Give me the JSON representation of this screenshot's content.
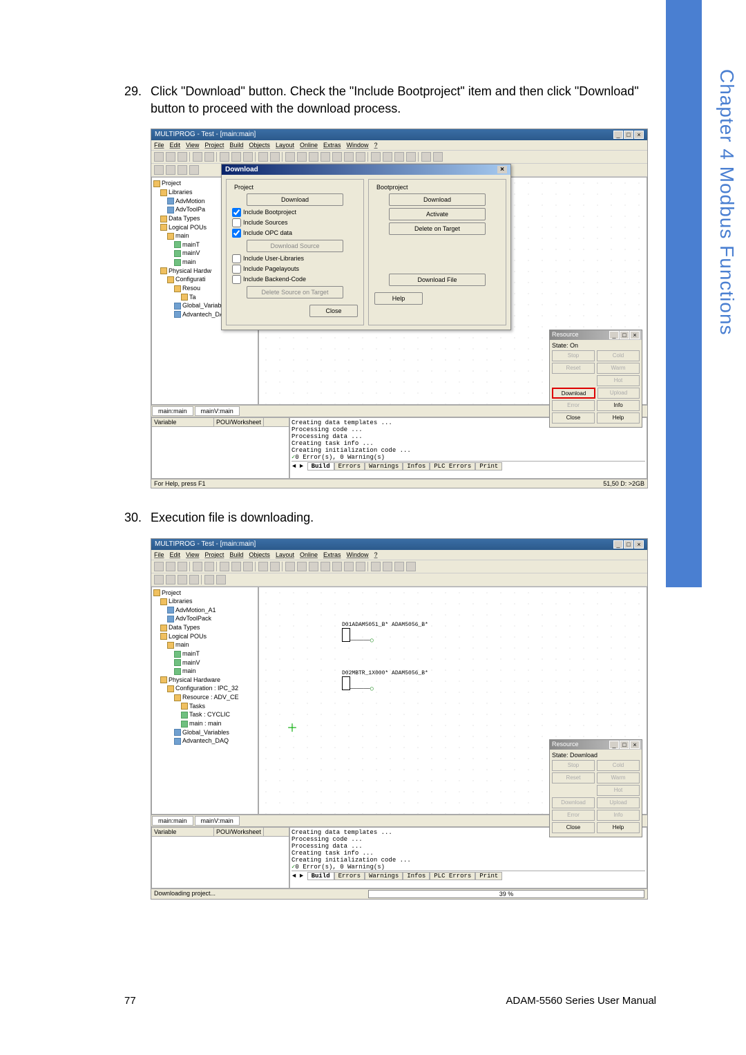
{
  "side_tab": "Chapter 4   Modbus Functions",
  "step29": {
    "num": "29.",
    "text": "Click \"Download\" button. Check the \"Include Bootproject\" item and then click \"Download\" button to proceed with the download process."
  },
  "step30": {
    "num": "30.",
    "text": "Execution file is downloading."
  },
  "screenshot1": {
    "title": "MULTIPROG - Test - [main:main]",
    "menu": [
      "File",
      "Edit",
      "View",
      "Project",
      "Build",
      "Objects",
      "Layout",
      "Online",
      "Extras",
      "Window",
      "?"
    ],
    "tree": {
      "root": "Project",
      "items": [
        {
          "l": 1,
          "t": "Libraries",
          "ic": "f"
        },
        {
          "l": 2,
          "t": "AdvMotion",
          "ic": "b"
        },
        {
          "l": 2,
          "t": "AdvToolPa",
          "ic": "b"
        },
        {
          "l": 1,
          "t": "Data Types",
          "ic": "f"
        },
        {
          "l": 1,
          "t": "Logical POUs",
          "ic": "f"
        },
        {
          "l": 2,
          "t": "main",
          "ic": "f"
        },
        {
          "l": 3,
          "t": "mainT",
          "ic": "g"
        },
        {
          "l": 3,
          "t": "mainV",
          "ic": "g"
        },
        {
          "l": 3,
          "t": "main",
          "ic": "g"
        },
        {
          "l": 1,
          "t": "Physical Hardw",
          "ic": "f"
        },
        {
          "l": 2,
          "t": "Configurati",
          "ic": "f"
        },
        {
          "l": 3,
          "t": "Resou",
          "ic": "f"
        },
        {
          "l": 4,
          "t": "Ta",
          "ic": "f"
        },
        {
          "l": 3,
          "t": "Global_Variables",
          "ic": "b"
        },
        {
          "l": 3,
          "t": "Advantech_DAQ",
          "ic": "b"
        }
      ]
    },
    "dialog": {
      "title": "Download",
      "groupProject": "Project",
      "groupBoot": "Bootproject",
      "btn_download_p": "Download",
      "btn_download_b": "Download",
      "btn_activate": "Activate",
      "btn_delete_target": "Delete on Target",
      "btn_download_source": "Download Source",
      "btn_delete_source": "Delete Source on Target",
      "btn_download_file": "Download File",
      "btn_close": "Close",
      "btn_help": "Help",
      "chk_bootproject": "Include Bootproject",
      "chk_sources": "Include Sources",
      "chk_opc": "Include OPC data",
      "chk_userlib": "Include User-Libraries",
      "chk_pagelayout": "Include Pagelayouts",
      "chk_backend": "Include Backend-Code"
    },
    "resource": {
      "title": "Resource",
      "state_label": "State:",
      "state_value": "On",
      "btn_stop": "Stop",
      "btn_cold": "Cold",
      "btn_reset": "Reset",
      "btn_warm": "Warm",
      "btn_hot": "Hot",
      "btn_download": "Download",
      "btn_upload": "Upload",
      "btn_error": "Error",
      "btn_info": "Info",
      "btn_close": "Close",
      "btn_help": "Help"
    },
    "tabs": [
      "main:main",
      "mainV:main"
    ],
    "var_hdr": [
      "Variable",
      "POU/Worksheet"
    ],
    "output": [
      "Creating data templates ...",
      "Processing code ...",
      "Processing data ...",
      "Creating task info ...",
      "Creating initialization code ...",
      "0 Error(s), 0 Warning(s)"
    ],
    "otabs": [
      "Build",
      "Errors",
      "Warnings",
      "Infos",
      "PLC Errors",
      "Print"
    ],
    "status_left": "For Help, press F1",
    "status_right": "51,50  D: >2GB"
  },
  "screenshot2": {
    "title": "MULTIPROG - Test - [main:main]",
    "menu": [
      "File",
      "Edit",
      "View",
      "Project",
      "Build",
      "Objects",
      "Layout",
      "Online",
      "Extras",
      "Window",
      "?"
    ],
    "tree": {
      "root": "Project",
      "items": [
        {
          "l": 1,
          "t": "Libraries",
          "ic": "f"
        },
        {
          "l": 2,
          "t": "AdvMotion_A1",
          "ic": "b"
        },
        {
          "l": 2,
          "t": "AdvToolPack",
          "ic": "b"
        },
        {
          "l": 1,
          "t": "Data Types",
          "ic": "f"
        },
        {
          "l": 1,
          "t": "Logical POUs",
          "ic": "f"
        },
        {
          "l": 2,
          "t": "main",
          "ic": "f"
        },
        {
          "l": 3,
          "t": "mainT",
          "ic": "g"
        },
        {
          "l": 3,
          "t": "mainV",
          "ic": "g"
        },
        {
          "l": 3,
          "t": "main",
          "ic": "g"
        },
        {
          "l": 1,
          "t": "Physical Hardware",
          "ic": "f"
        },
        {
          "l": 2,
          "t": "Configuration : IPC_32",
          "ic": "f"
        },
        {
          "l": 3,
          "t": "Resource : ADV_CE",
          "ic": "f"
        },
        {
          "l": 4,
          "t": "Tasks",
          "ic": "f"
        },
        {
          "l": 4,
          "t": "Task : CYCLIC",
          "ic": "g"
        },
        {
          "l": 4,
          "t": "main : main",
          "ic": "g"
        },
        {
          "l": 3,
          "t": "Global_Variables",
          "ic": "b"
        },
        {
          "l": 3,
          "t": "Advantech_DAQ",
          "ic": "b"
        }
      ]
    },
    "fbd1": "D01ADAM5051_B* ADAM5056_B*",
    "fbd2": "D02MBTR_1X000* ADAM5056_B*",
    "resource": {
      "title": "Resource",
      "state_label": "State:",
      "state_value": "Download",
      "btn_stop": "Stop",
      "btn_cold": "Cold",
      "btn_reset": "Reset",
      "btn_warm": "Warm",
      "btn_hot": "Hot",
      "btn_download": "Download",
      "btn_upload": "Upload",
      "btn_error": "Error",
      "btn_info": "Info",
      "btn_close": "Close",
      "btn_help": "Help"
    },
    "tabs": [
      "main:main",
      "mainV:main"
    ],
    "var_hdr": [
      "Variable",
      "POU/Worksheet"
    ],
    "output": [
      "Creating data templates ...",
      "Processing code ...",
      "Processing data ...",
      "Creating task info ...",
      "Creating initialization code ...",
      "0 Error(s), 0 Warning(s)"
    ],
    "otabs": [
      "Build",
      "Errors",
      "Warnings",
      "Infos",
      "PLC Errors",
      "Print"
    ],
    "status_left": "Downloading project...",
    "progress": "39 %"
  },
  "footer": {
    "page": "77",
    "doc": "ADAM-5560 Series User Manual"
  }
}
